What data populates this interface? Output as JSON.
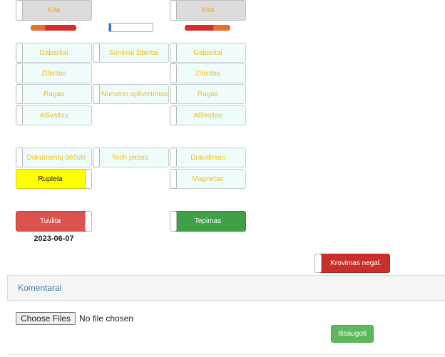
{
  "top": {
    "kita_left": "Kita",
    "kita_right": "Kita"
  },
  "progress": {
    "value": 0.05
  },
  "buttons": {
    "gabaritai_left": "Gabaritai",
    "soniniai_zibintai": "Šoniniai žibintai",
    "gabaritai_right": "Gabaritai",
    "zibintas_left": "Žibintas",
    "zibintas_right": "Žibintas",
    "ragas_left": "Ragas",
    "numerio_apsvietimas": "Numerio apšvietimas",
    "ragas_right": "Ragas",
    "atsvaitas_left": "Atšvaitas",
    "atsvaitas_right": "Atšvaitas",
    "dokumentu_dezute": "Dokumentų dėžutė",
    "tech_pasas": "Tech pasas.",
    "draudimas": "Draudimas",
    "ruptela": "Ruptela",
    "magnetas": "Magnetas",
    "tuvlita": "Tuvlita",
    "tepimas": "Tepimas",
    "krovimas": "Krovimas negal."
  },
  "tuvlita_date": "2023-06-07",
  "comments": {
    "title": "Komentarai"
  },
  "file": {
    "button_label": "Choose Files",
    "status": "No file chosen"
  },
  "save_label": "Išsaugoti",
  "colors": {
    "yellow_text": "#f0c020",
    "red": "#d9534f",
    "green": "#3fa047",
    "dark_red": "#c8302c",
    "orange_segment": "#e8702a",
    "blue_link": "#337ab7",
    "save_green": "#5cb85c"
  }
}
